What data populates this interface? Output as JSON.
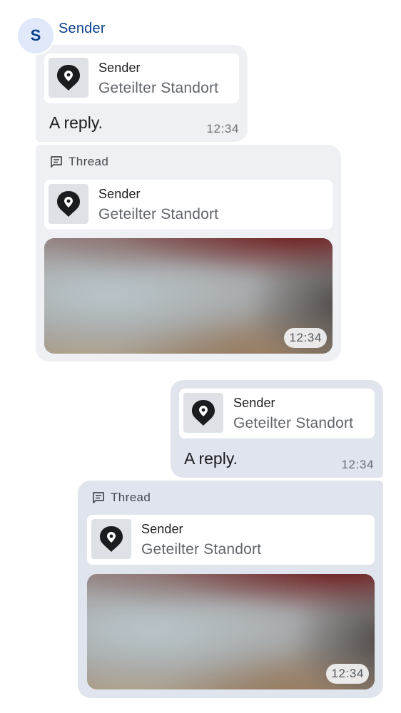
{
  "sender": {
    "avatar_initial": "S",
    "name": "Sender"
  },
  "messages": [
    {
      "direction": "incoming",
      "reply_to": {
        "sender": "Sender",
        "preview": "Geteilter Standort",
        "icon": "location-pin-icon"
      },
      "text": "A reply.",
      "time": "12:34"
    },
    {
      "direction": "incoming",
      "thread_label": "Thread",
      "reply_to": {
        "sender": "Sender",
        "preview": "Geteilter Standort",
        "icon": "location-pin-icon"
      },
      "image_time": "12:34"
    },
    {
      "direction": "outgoing",
      "reply_to": {
        "sender": "Sender",
        "preview": "Geteilter Standort",
        "icon": "location-pin-icon"
      },
      "text": "A reply.",
      "time": "12:34"
    },
    {
      "direction": "outgoing",
      "thread_label": "Thread",
      "reply_to": {
        "sender": "Sender",
        "preview": "Geteilter Standort",
        "icon": "location-pin-icon"
      },
      "image_time": "12:34"
    }
  ],
  "colors": {
    "incoming_bubble": "#eef0f4",
    "outgoing_bubble": "#e0e4ec",
    "sender_name": "#0a3f8c",
    "avatar_bg": "#dfe9fa"
  }
}
